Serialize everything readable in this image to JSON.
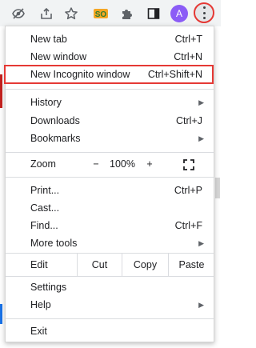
{
  "toolbar": {
    "icons": [
      "eye-off-icon",
      "share-icon",
      "star-icon",
      "extension-orange-icon",
      "puzzle-icon",
      "side-panel-icon"
    ],
    "avatar_letter": "A",
    "kebab": "menu-icon"
  },
  "menu": {
    "new_tab": {
      "label": "New tab",
      "shortcut": "Ctrl+T"
    },
    "new_window": {
      "label": "New window",
      "shortcut": "Ctrl+N"
    },
    "new_incognito": {
      "label": "New Incognito window",
      "shortcut": "Ctrl+Shift+N"
    },
    "history": {
      "label": "History"
    },
    "downloads": {
      "label": "Downloads",
      "shortcut": "Ctrl+J"
    },
    "bookmarks": {
      "label": "Bookmarks"
    },
    "zoom": {
      "label": "Zoom",
      "minus": "−",
      "value": "100%",
      "plus": "+"
    },
    "print": {
      "label": "Print...",
      "shortcut": "Ctrl+P"
    },
    "cast": {
      "label": "Cast..."
    },
    "find": {
      "label": "Find...",
      "shortcut": "Ctrl+F"
    },
    "more_tools": {
      "label": "More tools"
    },
    "edit": {
      "label": "Edit",
      "cut": "Cut",
      "copy": "Copy",
      "paste": "Paste"
    },
    "settings": {
      "label": "Settings"
    },
    "help": {
      "label": "Help"
    },
    "exit": {
      "label": "Exit"
    }
  },
  "colors": {
    "highlight": "#e53935",
    "avatar": "#8b5cf6"
  }
}
